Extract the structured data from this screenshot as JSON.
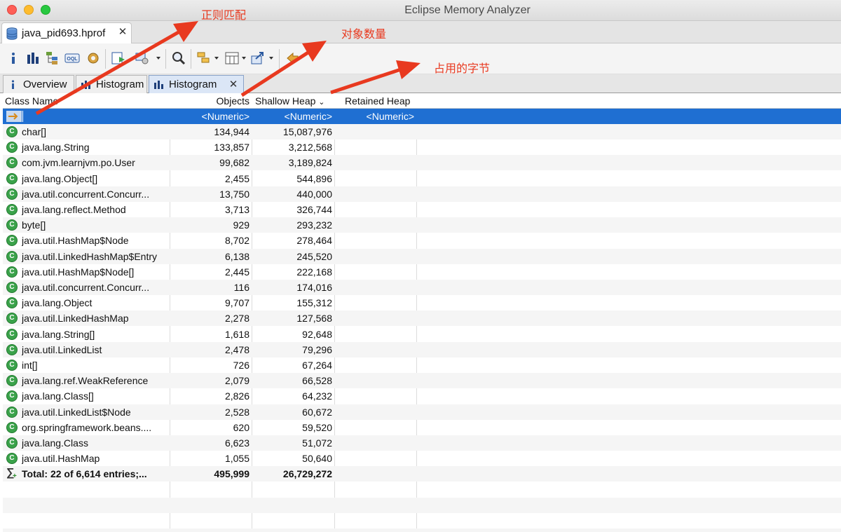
{
  "window": {
    "title": "Eclipse Memory Analyzer"
  },
  "editor_tab": {
    "label": "java_pid693.hprof"
  },
  "toolbar": {
    "icons": [
      "info-icon",
      "histogram-icon",
      "dominator-tree-icon",
      "oql-icon",
      "heap-dump-overview-icon",
      "run-report-icon",
      "query-browser-icon",
      "search-icon",
      "group-by-icon",
      "calculate-retained-icon",
      "export-icon",
      "back-icon"
    ]
  },
  "subtabs": [
    {
      "label": "Overview"
    },
    {
      "label": "Histogram"
    },
    {
      "label": "Histogram"
    }
  ],
  "table": {
    "columns": {
      "class_name": "Class Name",
      "objects": "Objects",
      "shallow_heap": "Shallow Heap",
      "retained_heap": "Retained Heap"
    },
    "regex_row": {
      "objects": "<Numeric>",
      "shallow_heap": "<Numeric>",
      "retained_heap": "<Numeric>"
    },
    "rows": [
      {
        "name": "char[]",
        "objects": "134,944",
        "shallow": "15,087,976"
      },
      {
        "name": "java.lang.String",
        "objects": "133,857",
        "shallow": "3,212,568"
      },
      {
        "name": "com.jvm.learnjvm.po.User",
        "objects": "99,682",
        "shallow": "3,189,824"
      },
      {
        "name": "java.lang.Object[]",
        "objects": "2,455",
        "shallow": "544,896"
      },
      {
        "name": "java.util.concurrent.Concurr...",
        "objects": "13,750",
        "shallow": "440,000"
      },
      {
        "name": "java.lang.reflect.Method",
        "objects": "3,713",
        "shallow": "326,744"
      },
      {
        "name": "byte[]",
        "objects": "929",
        "shallow": "293,232"
      },
      {
        "name": "java.util.HashMap$Node",
        "objects": "8,702",
        "shallow": "278,464"
      },
      {
        "name": "java.util.LinkedHashMap$Entry",
        "objects": "6,138",
        "shallow": "245,520"
      },
      {
        "name": "java.util.HashMap$Node[]",
        "objects": "2,445",
        "shallow": "222,168"
      },
      {
        "name": "java.util.concurrent.Concurr...",
        "objects": "116",
        "shallow": "174,016"
      },
      {
        "name": "java.lang.Object",
        "objects": "9,707",
        "shallow": "155,312"
      },
      {
        "name": "java.util.LinkedHashMap",
        "objects": "2,278",
        "shallow": "127,568"
      },
      {
        "name": "java.lang.String[]",
        "objects": "1,618",
        "shallow": "92,648"
      },
      {
        "name": "java.util.LinkedList",
        "objects": "2,478",
        "shallow": "79,296"
      },
      {
        "name": "int[]",
        "objects": "726",
        "shallow": "67,264"
      },
      {
        "name": "java.lang.ref.WeakReference",
        "objects": "2,079",
        "shallow": "66,528"
      },
      {
        "name": "java.lang.Class[]",
        "objects": "2,826",
        "shallow": "64,232"
      },
      {
        "name": "java.util.LinkedList$Node",
        "objects": "2,528",
        "shallow": "60,672"
      },
      {
        "name": "org.springframework.beans....",
        "objects": "620",
        "shallow": "59,520"
      },
      {
        "name": "java.lang.Class",
        "objects": "6,623",
        "shallow": "51,072"
      },
      {
        "name": "java.util.HashMap",
        "objects": "1,055",
        "shallow": "50,640"
      }
    ],
    "total": {
      "label": "Total: 22 of 6,614 entries;...",
      "objects": "495,999",
      "shallow": "26,729,272"
    }
  },
  "annotations": {
    "regex": "正则匹配",
    "object_count": "对象数量",
    "bytes_used": "占用的字节",
    "color": "#e8391f"
  }
}
